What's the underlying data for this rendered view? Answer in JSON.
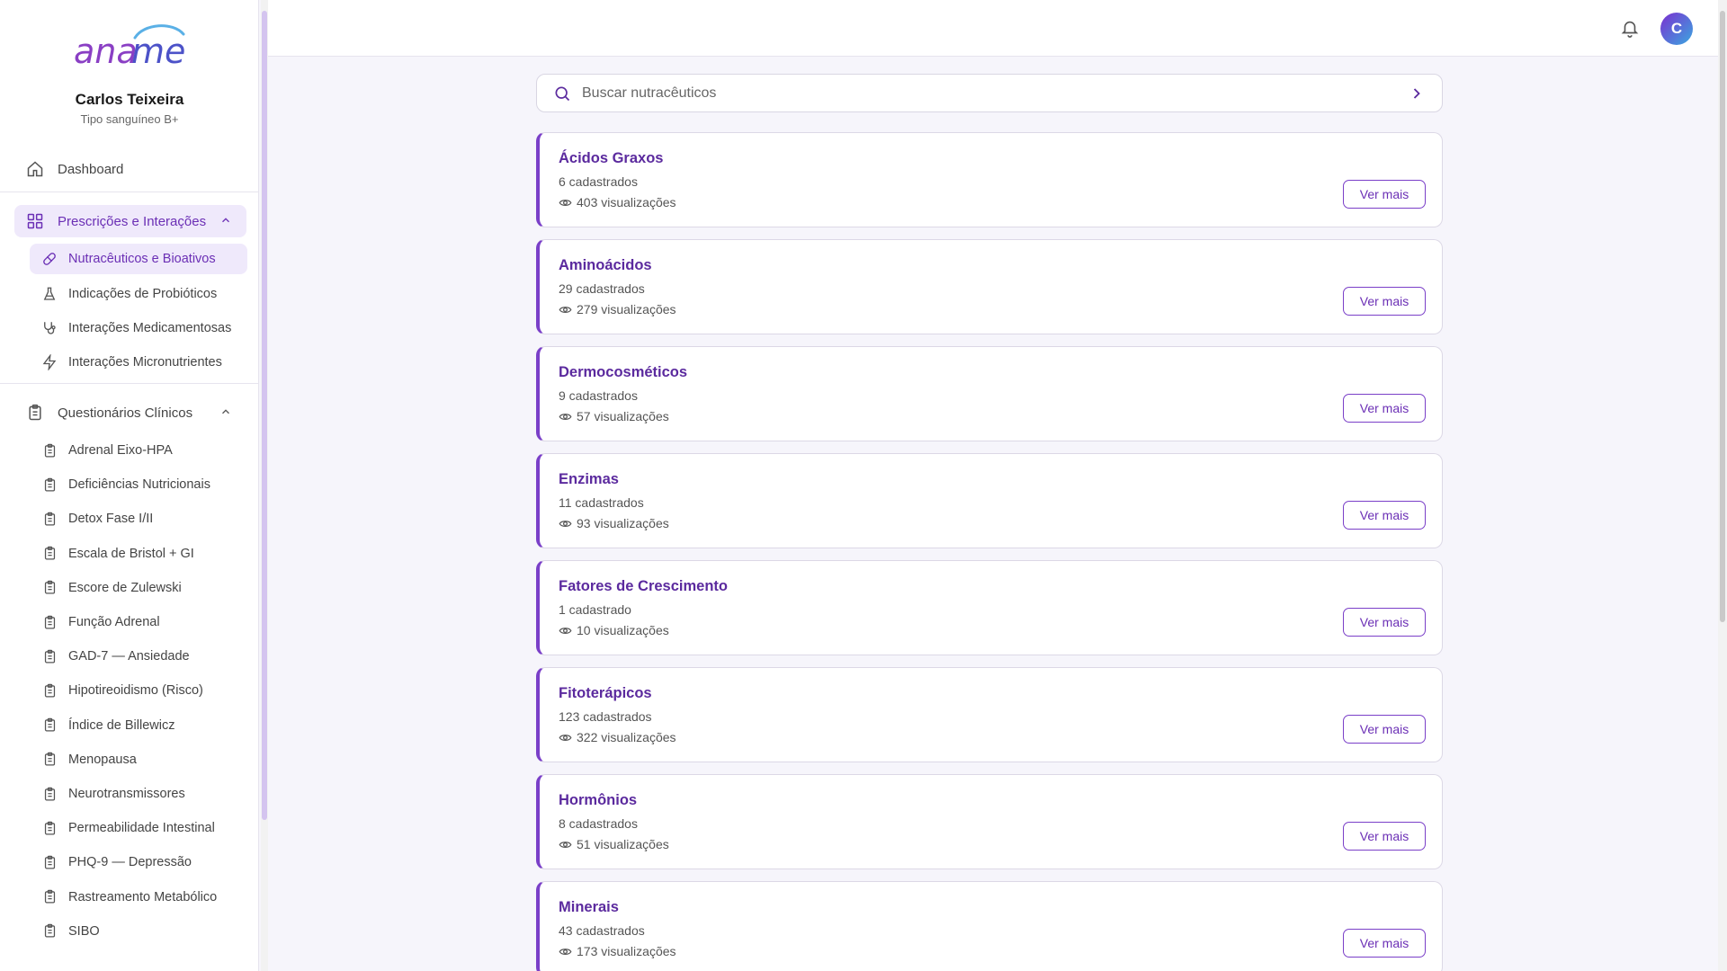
{
  "brand": {
    "logo_text_a": "ana",
    "logo_text_b": "me",
    "accent": "#7a3fc8"
  },
  "user": {
    "name": "Carlos Teixeira",
    "subtitle": "Tipo sanguíneo B+",
    "avatar_initial": "C"
  },
  "sidebar": {
    "dashboard": {
      "label": "Dashboard",
      "icon": "home-icon"
    },
    "group_prescricoes": {
      "label": "Prescrições e Interações",
      "icon": "grid-icon",
      "items": [
        {
          "label": "Nutracêuticos e Bioativos",
          "icon": "pill-icon"
        },
        {
          "label": "Indicações de Probióticos",
          "icon": "flask-icon"
        },
        {
          "label": "Interações Medicamentosas",
          "icon": "stethoscope-icon"
        },
        {
          "label": "Interações Micronutrientes",
          "icon": "bolt-icon"
        }
      ]
    },
    "group_questionarios": {
      "label": "Questionários Clínicos",
      "icon": "clipboard-icon",
      "items": [
        {
          "label": "Adrenal Eixo-HPA"
        },
        {
          "label": "Deficiências Nutricionais"
        },
        {
          "label": "Detox Fase I/II"
        },
        {
          "label": "Escala de Bristol + GI"
        },
        {
          "label": "Escore de Zulewski"
        },
        {
          "label": "Função Adrenal"
        },
        {
          "label": "GAD-7 — Ansiedade"
        },
        {
          "label": "Hipotireoidismo (Risco)"
        },
        {
          "label": "Índice de Billewicz"
        },
        {
          "label": "Menopausa"
        },
        {
          "label": "Neurotransmissores"
        },
        {
          "label": "Permeabilidade Intestinal"
        },
        {
          "label": "PHQ-9 — Depressão"
        },
        {
          "label": "Rastreamento Metabólico"
        },
        {
          "label": "SIBO"
        }
      ]
    }
  },
  "search": {
    "placeholder": "Buscar nutracêuticos"
  },
  "cards": [
    {
      "title": "Ácidos Graxos",
      "count": "6 cadastrados",
      "views": "403 visualizações",
      "button": "Ver mais"
    },
    {
      "title": "Aminoácidos",
      "count": "29 cadastrados",
      "views": "279 visualizações",
      "button": "Ver mais"
    },
    {
      "title": "Dermocosméticos",
      "count": "9 cadastrados",
      "views": "57 visualizações",
      "button": "Ver mais"
    },
    {
      "title": "Enzimas",
      "count": "11 cadastrados",
      "views": "93 visualizações",
      "button": "Ver mais"
    },
    {
      "title": "Fatores de Crescimento",
      "count": "1 cadastrado",
      "views": "10 visualizações",
      "button": "Ver mais"
    },
    {
      "title": "Fitoterápicos",
      "count": "123 cadastrados",
      "views": "322 visualizações",
      "button": "Ver mais"
    },
    {
      "title": "Hormônios",
      "count": "8 cadastrados",
      "views": "51 visualizações",
      "button": "Ver mais"
    },
    {
      "title": "Minerais",
      "count": "43 cadastrados",
      "views": "173 visualizações",
      "button": "Ver mais"
    }
  ]
}
